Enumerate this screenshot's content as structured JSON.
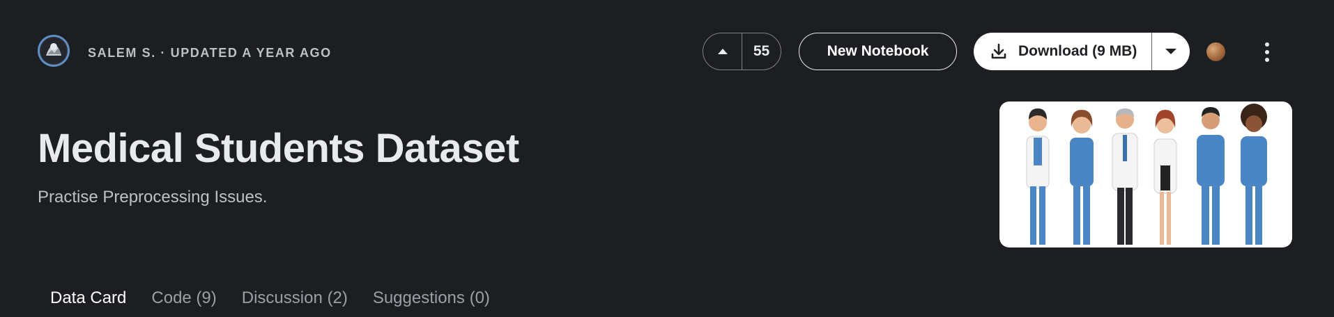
{
  "header": {
    "author_line": "SALEM S. · UPDATED A YEAR AGO",
    "avatar_icon": "user-avatar",
    "vote": {
      "icon": "caret-up-icon",
      "count": "55"
    },
    "new_notebook_label": "New Notebook",
    "download": {
      "label": "Download (9 MB)",
      "icon": "download-icon",
      "menu_icon": "caret-down-icon"
    },
    "badge_icon": "bronze-medal-icon",
    "more_icon": "more-vert-icon"
  },
  "dataset": {
    "title": "Medical Students Dataset",
    "subtitle": "Practise Preprocessing Issues."
  },
  "tabs": [
    {
      "label": "Data Card",
      "active": true
    },
    {
      "label": "Code (9)",
      "active": false
    },
    {
      "label": "Discussion (2)",
      "active": false
    },
    {
      "label": "Suggestions (0)",
      "active": false
    }
  ],
  "colors": {
    "background": "#1d1e22",
    "text": "#e8eaed",
    "muted": "#9aa0a6",
    "button_fill": "#ffffff",
    "scrubs_blue": "#4a86c5"
  }
}
